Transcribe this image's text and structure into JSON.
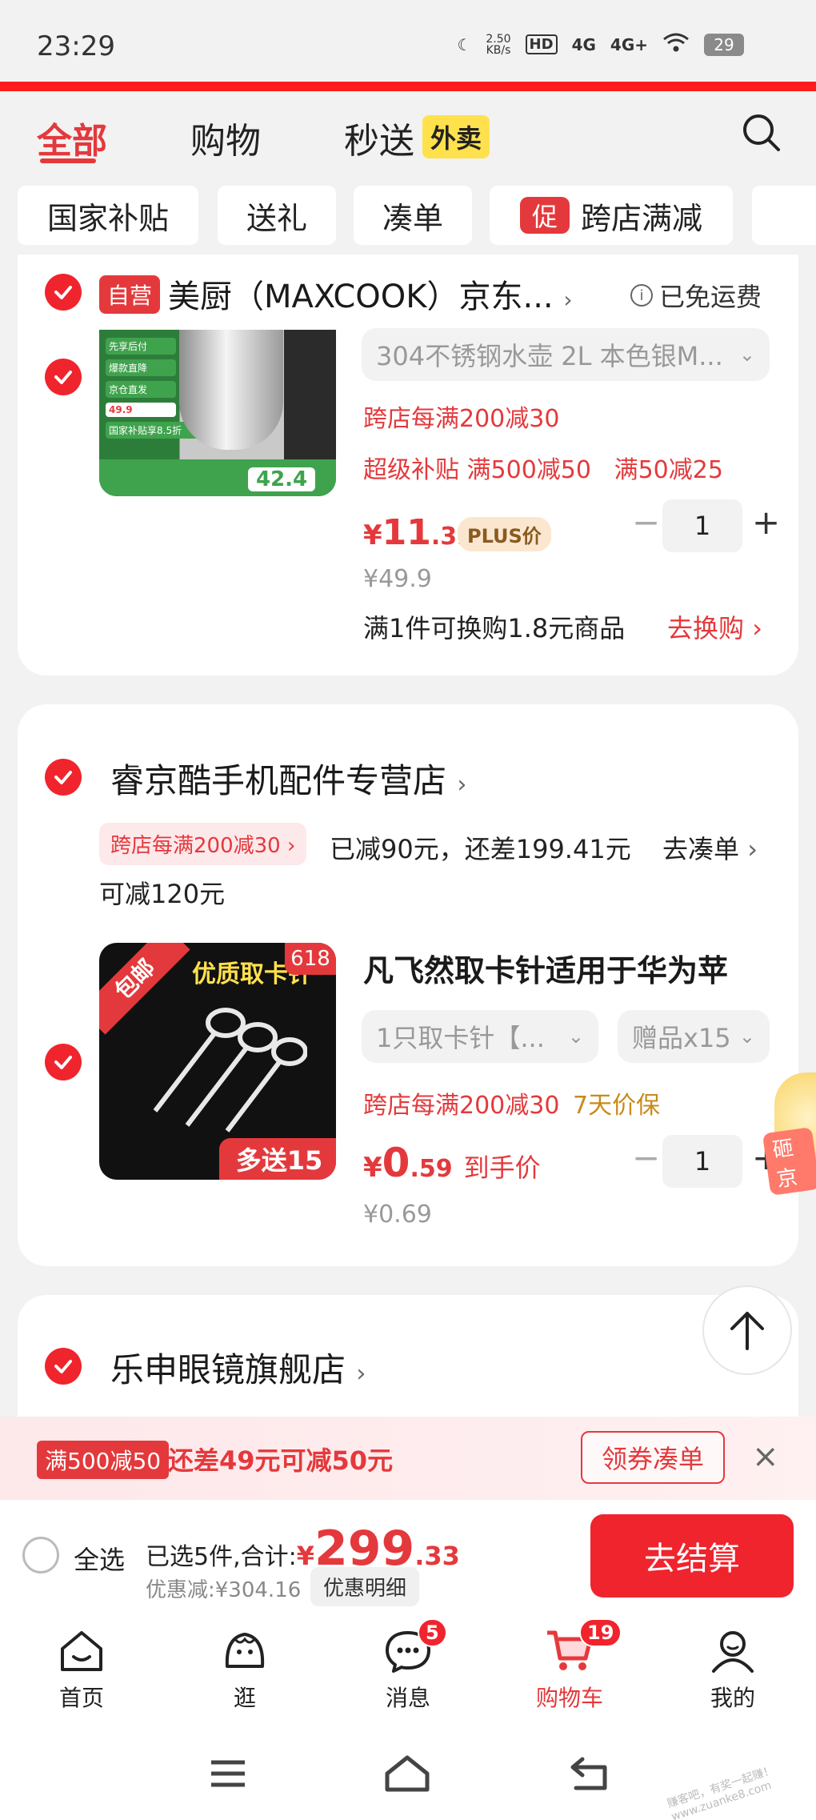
{
  "status_bar": {
    "time": "23:29",
    "speed": "2.50\nKB/s",
    "net1": "4G",
    "net2": "4G+",
    "battery": "29"
  },
  "tabs": [
    {
      "label": "全部"
    },
    {
      "label": "购物"
    },
    {
      "label": "秒送"
    }
  ],
  "waimai_badge": "外卖",
  "chips": [
    "国家补贴",
    "送礼",
    "凑单",
    "跨店满减"
  ],
  "chip_cu": "促",
  "shop1": {
    "self_badge": "自营",
    "name": "美厨（MAXCOOK）京东...",
    "free_ship": "已免运费",
    "product": {
      "variant": "304不锈钢水壶 2L 本色银M...",
      "promo1": "跨店每满200减30",
      "promo2": "超级补贴 满500减50   满50减25",
      "price_int": "11",
      "price_dec": ".32",
      "price_sym": "¥",
      "plus_label": "PLUS价",
      "orig_price": "¥49.9",
      "qty": "1",
      "exchange_text": "满1件可换购1.8元商品",
      "exchange_link": "去换购",
      "thumb_texts": [
        "先享后付",
        "爆款直降",
        "京仓直发",
        "49.9",
        "国家补贴享8.5折",
        "42.4"
      ]
    }
  },
  "shop2": {
    "name": "睿京酷手机配件专营店",
    "promo_tag": "跨店每满200减30",
    "promo_text": "已减90元，还差199.41元",
    "promo_link": "去凑单",
    "promo_text2": "可减120元",
    "product": {
      "title": "凡飞然取卡针适用于华为苹",
      "variant": "1只取卡针【...",
      "gift": "赠品x15",
      "promo": "跨店每满200减30",
      "guarantee": "7天价保",
      "price_sym": "¥",
      "price_int": "0",
      "price_dec": ".59",
      "price_note": "到手价",
      "orig_price": "¥0.69",
      "qty": "1",
      "thumb_texts": {
        "ribbon": "包邮",
        "headline": "优质取卡针",
        "tag": "618",
        "bottom": "多送15"
      },
      "egg_text": "砸京"
    }
  },
  "shop3": {
    "name": "乐申眼镜旗舰店"
  },
  "promo_bar": {
    "tag": "满500减50",
    "text": "还差49元可减50元",
    "button": "领券凑单"
  },
  "checkout": {
    "select_all": "全选",
    "summary": "已选5件,合计:",
    "currency": "¥",
    "total_int": "299",
    "total_dec": ".33",
    "discount": "优惠减:¥304.16",
    "discount_detail": "优惠明细",
    "submit": "去结算"
  },
  "bottom_nav": [
    {
      "label": "首页",
      "icon": "home-icon"
    },
    {
      "label": "逛",
      "icon": "browse-icon"
    },
    {
      "label": "消息",
      "icon": "message-icon",
      "badge": "5"
    },
    {
      "label": "购物车",
      "icon": "cart-icon",
      "badge": "19"
    },
    {
      "label": "我的",
      "icon": "profile-icon"
    }
  ],
  "watermark": "赚客吧，有奖一起赚！ www.zuanke8.com",
  "colors": {
    "accent": "#e4393c",
    "checkout": "#f0242d",
    "tab_yellow": "#ffe14d"
  }
}
